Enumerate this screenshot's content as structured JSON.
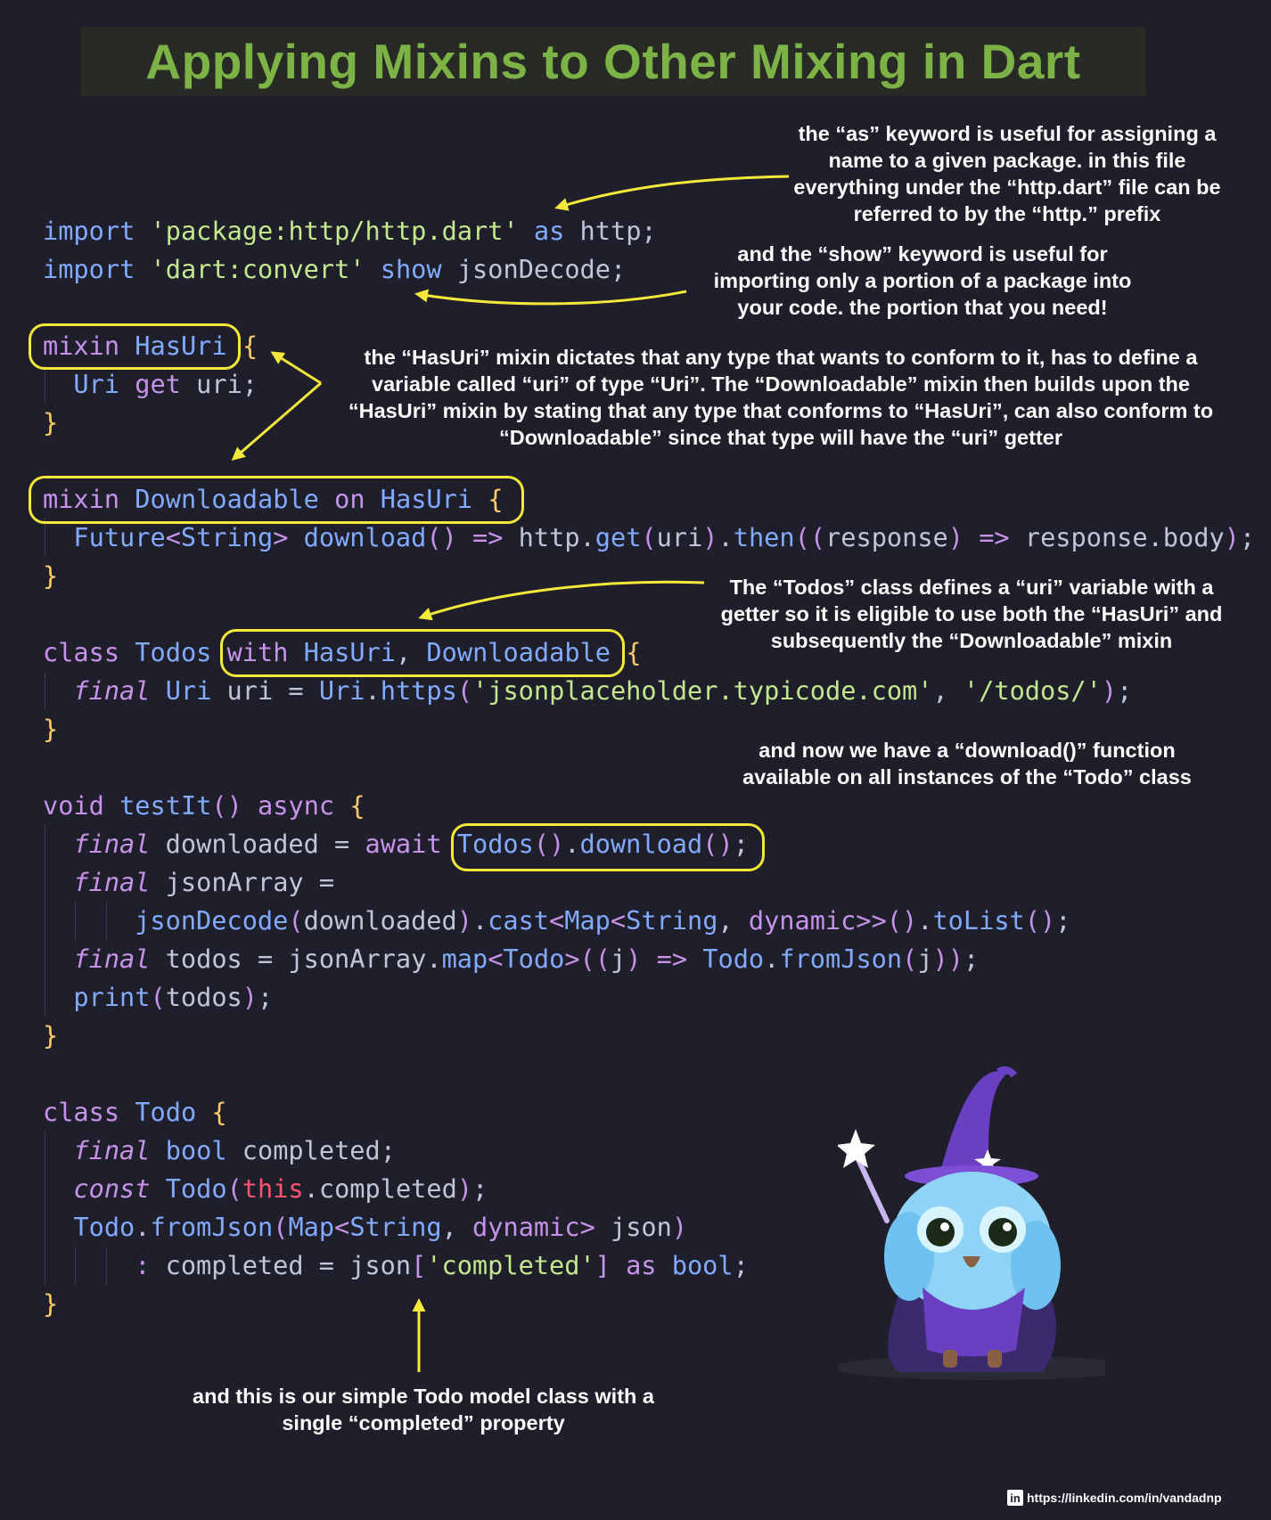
{
  "title": "Applying Mixins to Other Mixing in Dart",
  "colors": {
    "background": "#1f1e2b",
    "title": "#7db346",
    "highlight": "#f4e83a",
    "keyword": "#c792ea",
    "type": "#82aaff",
    "string": "#c3e88d",
    "this_keyword": "#ff5370",
    "brace": "#ffcb6b"
  },
  "code": [
    {
      "indent": 0,
      "tokens": [
        [
          "kb",
          "import"
        ],
        [
          "p",
          " "
        ],
        [
          "s",
          "'package:http/http.dart'"
        ],
        [
          "p",
          " "
        ],
        [
          "kb",
          "as"
        ],
        [
          "p",
          " http;"
        ]
      ]
    },
    {
      "indent": 0,
      "tokens": [
        [
          "kb",
          "import"
        ],
        [
          "p",
          " "
        ],
        [
          "s",
          "'dart:convert'"
        ],
        [
          "p",
          " "
        ],
        [
          "kb",
          "show"
        ],
        [
          "p",
          " jsonDecode;"
        ]
      ]
    },
    {
      "indent": 0,
      "tokens": []
    },
    {
      "indent": 0,
      "tokens": [
        [
          "k",
          "mixin"
        ],
        [
          "p",
          " "
        ],
        [
          "t",
          "HasUri"
        ],
        [
          "p",
          " "
        ],
        [
          "b",
          "{"
        ]
      ]
    },
    {
      "indent": 1,
      "tokens": [
        [
          "t",
          "Uri"
        ],
        [
          "p",
          " "
        ],
        [
          "k",
          "get"
        ],
        [
          "p",
          " uri;"
        ]
      ]
    },
    {
      "indent": 0,
      "tokens": [
        [
          "b",
          "}"
        ]
      ]
    },
    {
      "indent": 0,
      "tokens": []
    },
    {
      "indent": 0,
      "tokens": [
        [
          "k",
          "mixin"
        ],
        [
          "p",
          " "
        ],
        [
          "t",
          "Downloadable"
        ],
        [
          "p",
          " "
        ],
        [
          "k",
          "on"
        ],
        [
          "p",
          " "
        ],
        [
          "t",
          "HasUri"
        ],
        [
          "p",
          " "
        ],
        [
          "b",
          "{"
        ]
      ]
    },
    {
      "indent": 1,
      "tokens": [
        [
          "t",
          "Future"
        ],
        [
          "k",
          "<"
        ],
        [
          "t",
          "String"
        ],
        [
          "k",
          ">"
        ],
        [
          "p",
          " "
        ],
        [
          "f",
          "download"
        ],
        [
          "k",
          "()"
        ],
        [
          "p",
          " "
        ],
        [
          "k",
          "=>"
        ],
        [
          "p",
          " http."
        ],
        [
          "f",
          "get"
        ],
        [
          "k",
          "("
        ],
        [
          "p",
          "uri"
        ],
        [
          "k",
          ")"
        ],
        [
          "p",
          "."
        ],
        [
          "f",
          "then"
        ],
        [
          "k",
          "(("
        ],
        [
          "p",
          "response"
        ],
        [
          "k",
          ")"
        ],
        [
          "p",
          " "
        ],
        [
          "k",
          "=>"
        ],
        [
          "p",
          " response.body"
        ],
        [
          "k",
          ")"
        ],
        [
          "p",
          ";"
        ]
      ]
    },
    {
      "indent": 0,
      "tokens": [
        [
          "b",
          "}"
        ]
      ]
    },
    {
      "indent": 0,
      "tokens": []
    },
    {
      "indent": 0,
      "tokens": [
        [
          "k",
          "class"
        ],
        [
          "p",
          " "
        ],
        [
          "t",
          "Todos"
        ],
        [
          "p",
          " "
        ],
        [
          "k",
          "with"
        ],
        [
          "p",
          " "
        ],
        [
          "t",
          "HasUri"
        ],
        [
          "p",
          ", "
        ],
        [
          "t",
          "Downloadable"
        ],
        [
          "p",
          " "
        ],
        [
          "b",
          "{"
        ]
      ]
    },
    {
      "indent": 1,
      "tokens": [
        [
          "i",
          "final"
        ],
        [
          "p",
          " "
        ],
        [
          "t",
          "Uri"
        ],
        [
          "p",
          " uri = "
        ],
        [
          "t",
          "Uri"
        ],
        [
          "p",
          "."
        ],
        [
          "f",
          "https"
        ],
        [
          "k",
          "("
        ],
        [
          "s",
          "'jsonplaceholder.typicode.com'"
        ],
        [
          "p",
          ", "
        ],
        [
          "s",
          "'/todos/'"
        ],
        [
          "k",
          ")"
        ],
        [
          "p",
          ";"
        ]
      ]
    },
    {
      "indent": 0,
      "tokens": [
        [
          "b",
          "}"
        ]
      ]
    },
    {
      "indent": 0,
      "tokens": []
    },
    {
      "indent": 0,
      "tokens": [
        [
          "k",
          "void"
        ],
        [
          "p",
          " "
        ],
        [
          "f",
          "testIt"
        ],
        [
          "k",
          "()"
        ],
        [
          "p",
          " "
        ],
        [
          "k",
          "async"
        ],
        [
          "p",
          " "
        ],
        [
          "b",
          "{"
        ]
      ]
    },
    {
      "indent": 1,
      "tokens": [
        [
          "i",
          "final"
        ],
        [
          "p",
          " downloaded = "
        ],
        [
          "k",
          "await"
        ],
        [
          "p",
          " "
        ],
        [
          "t",
          "Todos"
        ],
        [
          "k",
          "()"
        ],
        [
          "p",
          "."
        ],
        [
          "f",
          "download"
        ],
        [
          "k",
          "()"
        ],
        [
          "p",
          ";"
        ]
      ]
    },
    {
      "indent": 1,
      "tokens": [
        [
          "i",
          "final"
        ],
        [
          "p",
          " jsonArray ="
        ]
      ]
    },
    {
      "indent": 3,
      "tokens": [
        [
          "f",
          "jsonDecode"
        ],
        [
          "k",
          "("
        ],
        [
          "p",
          "downloaded"
        ],
        [
          "k",
          ")"
        ],
        [
          "p",
          "."
        ],
        [
          "f",
          "cast"
        ],
        [
          "k",
          "<"
        ],
        [
          "t",
          "Map"
        ],
        [
          "k",
          "<"
        ],
        [
          "t",
          "String"
        ],
        [
          "p",
          ", "
        ],
        [
          "k",
          "dynamic"
        ],
        [
          "k",
          ">>()"
        ],
        [
          "p",
          "."
        ],
        [
          "f",
          "toList"
        ],
        [
          "k",
          "()"
        ],
        [
          "p",
          ";"
        ]
      ]
    },
    {
      "indent": 1,
      "tokens": [
        [
          "i",
          "final"
        ],
        [
          "p",
          " todos = jsonArray."
        ],
        [
          "f",
          "map"
        ],
        [
          "k",
          "<"
        ],
        [
          "t",
          "Todo"
        ],
        [
          "k",
          ">(("
        ],
        [
          "p",
          "j"
        ],
        [
          "k",
          ")"
        ],
        [
          "p",
          " "
        ],
        [
          "k",
          "=>"
        ],
        [
          "p",
          " "
        ],
        [
          "t",
          "Todo"
        ],
        [
          "p",
          "."
        ],
        [
          "f",
          "fromJson"
        ],
        [
          "k",
          "("
        ],
        [
          "p",
          "j"
        ],
        [
          "k",
          "))"
        ],
        [
          "p",
          ";"
        ]
      ]
    },
    {
      "indent": 1,
      "tokens": [
        [
          "f",
          "print"
        ],
        [
          "k",
          "("
        ],
        [
          "p",
          "todos"
        ],
        [
          "k",
          ")"
        ],
        [
          "p",
          ";"
        ]
      ]
    },
    {
      "indent": 0,
      "tokens": [
        [
          "b",
          "}"
        ]
      ]
    },
    {
      "indent": 0,
      "tokens": []
    },
    {
      "indent": 0,
      "tokens": [
        [
          "k",
          "class"
        ],
        [
          "p",
          " "
        ],
        [
          "t",
          "Todo"
        ],
        [
          "p",
          " "
        ],
        [
          "b",
          "{"
        ]
      ]
    },
    {
      "indent": 1,
      "tokens": [
        [
          "i",
          "final"
        ],
        [
          "p",
          " "
        ],
        [
          "t",
          "bool"
        ],
        [
          "p",
          " completed;"
        ]
      ]
    },
    {
      "indent": 1,
      "tokens": [
        [
          "i",
          "const"
        ],
        [
          "p",
          " "
        ],
        [
          "t",
          "Todo"
        ],
        [
          "k",
          "("
        ],
        [
          "r",
          "this"
        ],
        [
          "p",
          ".completed"
        ],
        [
          "k",
          ")"
        ],
        [
          "p",
          ";"
        ]
      ]
    },
    {
      "indent": 1,
      "tokens": [
        [
          "t",
          "Todo"
        ],
        [
          "p",
          "."
        ],
        [
          "f",
          "fromJson"
        ],
        [
          "k",
          "("
        ],
        [
          "t",
          "Map"
        ],
        [
          "k",
          "<"
        ],
        [
          "t",
          "String"
        ],
        [
          "p",
          ", "
        ],
        [
          "k",
          "dynamic"
        ],
        [
          "k",
          ">"
        ],
        [
          "p",
          " json"
        ],
        [
          "k",
          ")"
        ]
      ]
    },
    {
      "indent": 3,
      "tokens": [
        [
          "k",
          ":"
        ],
        [
          "p",
          " completed = json"
        ],
        [
          "k",
          "["
        ],
        [
          "s",
          "'completed'"
        ],
        [
          "k",
          "]"
        ],
        [
          "p",
          " "
        ],
        [
          "k",
          "as"
        ],
        [
          "p",
          " "
        ],
        [
          "t",
          "bool"
        ],
        [
          "p",
          ";"
        ]
      ]
    },
    {
      "indent": 0,
      "tokens": [
        [
          "b",
          "}"
        ]
      ]
    }
  ],
  "notes": {
    "as_keyword": "the “as” keyword is useful for assigning a name to a given package. in this file everything under the “http.dart” file can be referred to by the “http.” prefix",
    "show_keyword": "and the “show” keyword is useful for importing only a portion of a package into your code. the portion that you need!",
    "hasuri_mixin": "the “HasUri” mixin dictates that any type that wants to conform to it, has to define a variable called “uri” of type “Uri”. The “Downloadable” mixin then builds upon the “HasUri” mixin by stating that any type that conforms to “HasUri”, can also conform to “Downloadable” since that type will have the “uri” getter",
    "todos_class": "The “Todos” class defines a “uri” variable with a getter so it is eligible to use both the “HasUri” and subsequently the “Downloadable” mixin",
    "download_function": "and now we have a “download()” function available on all instances of the “Todo” class",
    "todo_model": "and this is our simple Todo model class with a single “completed” property"
  },
  "footer": {
    "icon": "linkedin-icon",
    "icon_text": "in",
    "url": "https://linkedin.com/in/vandadnp"
  },
  "mascot": {
    "icon": "wizard-owl-mascot"
  }
}
